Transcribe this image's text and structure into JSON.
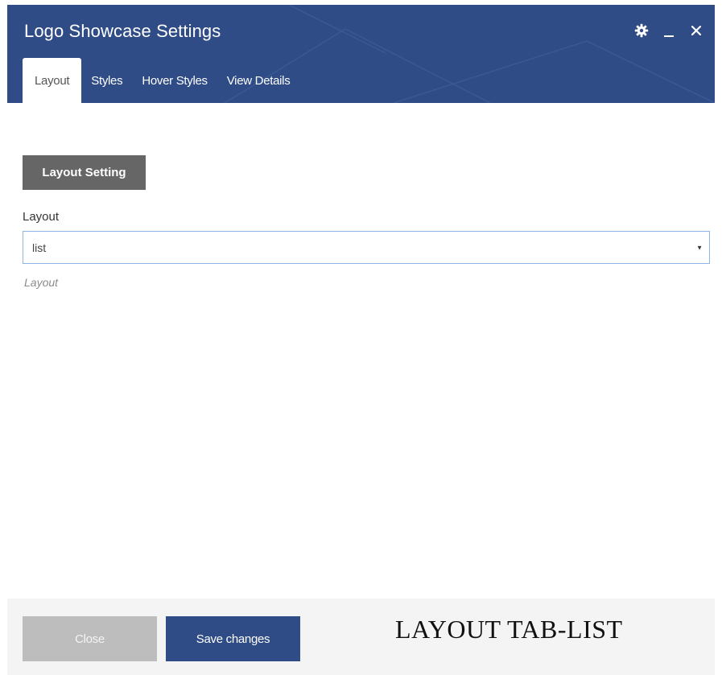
{
  "window": {
    "title": "Logo Showcase Settings",
    "controls": [
      {
        "name": "gear-icon",
        "glyph": "✿"
      },
      {
        "name": "minimize-icon",
        "glyph": "_"
      },
      {
        "name": "close-icon",
        "glyph": "✕"
      }
    ]
  },
  "tabs": [
    {
      "label": "Layout",
      "active": true
    },
    {
      "label": "Styles",
      "active": false
    },
    {
      "label": "Hover Styles",
      "active": false
    },
    {
      "label": "View Details",
      "active": false
    }
  ],
  "section": {
    "heading": "Layout Setting",
    "field_label": "Layout",
    "select_value": "list",
    "help_text": "Layout"
  },
  "footer": {
    "close_label": "Close",
    "save_label": "Save changes",
    "caption": "LAYOUT TAB-LIST"
  },
  "colors": {
    "header_bg": "#2f4c87",
    "section_heading_bg": "#666666",
    "close_button_bg": "#bdbdbd",
    "save_button_bg": "#2f4c87",
    "select_border": "#8fb4e6"
  }
}
